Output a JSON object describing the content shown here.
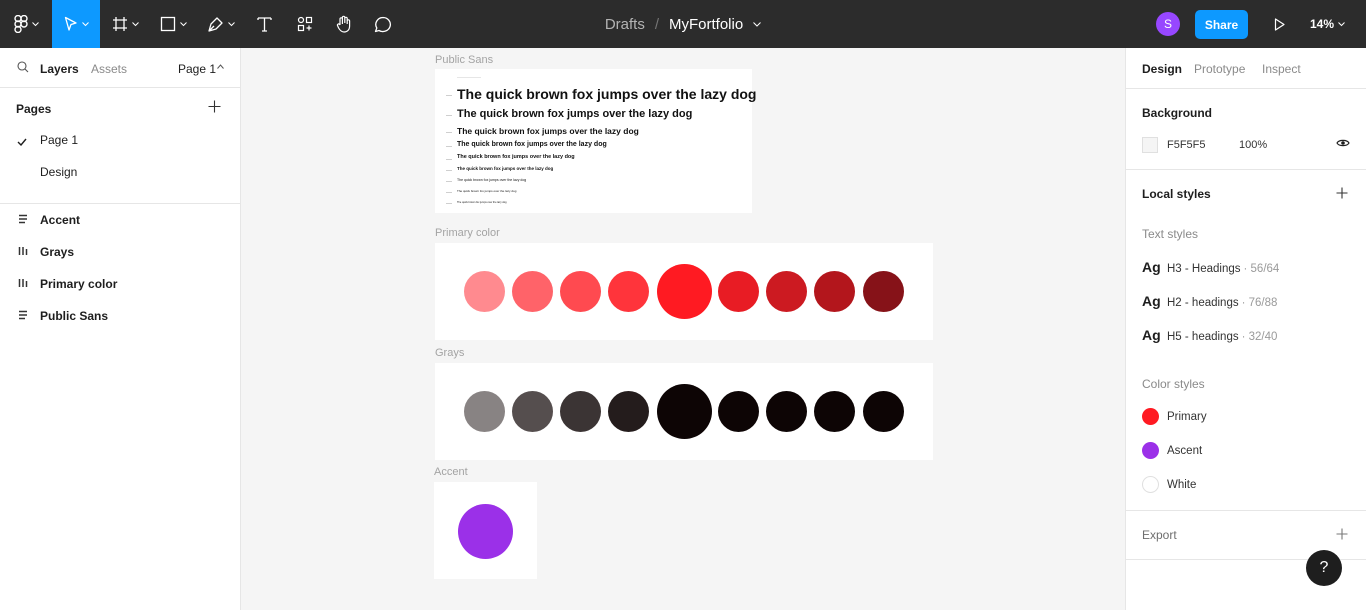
{
  "toolbar": {
    "breadcrumb_folder": "Drafts",
    "breadcrumb_separator": "/",
    "file_name": "MyFortfolio",
    "avatar_initial": "S",
    "share_label": "Share",
    "zoom_level": "14%"
  },
  "left_panel": {
    "tabs": {
      "layers": "Layers",
      "assets": "Assets"
    },
    "page_selector": "Page 1",
    "pages_heading": "Pages",
    "pages": [
      {
        "label": "Page 1",
        "selected": true
      },
      {
        "label": "Design",
        "selected": false
      }
    ],
    "layers": [
      {
        "name": "Accent",
        "icon": "vertical-stack-icon"
      },
      {
        "name": "Grays",
        "icon": "horizontal-stack-icon"
      },
      {
        "name": "Primary color",
        "icon": "horizontal-stack-icon"
      },
      {
        "name": "Public Sans",
        "icon": "vertical-stack-icon"
      }
    ]
  },
  "canvas": {
    "frames": {
      "public_sans": {
        "label": "Public Sans",
        "sample_text": "The quick brown fox jumps over the lazy dog"
      },
      "primary": {
        "label": "Primary color",
        "swatches": [
          "#ff8a8f",
          "#ff6369",
          "#ff4a50",
          "#ff343b",
          "#ff1a22",
          "#e81c24",
          "#cc1a21",
          "#b3161c",
          "#861218"
        ]
      },
      "grays": {
        "label": "Grays",
        "swatches": [
          "#888383",
          "#554e4e",
          "#3b3434",
          "#241c1c",
          "#0d0505",
          "#0d0505",
          "#0d0505",
          "#0d0505",
          "#0d0505"
        ]
      },
      "accent": {
        "label": "Accent",
        "swatch": "#9b30e8"
      }
    }
  },
  "right_panel": {
    "tabs": {
      "design": "Design",
      "prototype": "Prototype",
      "inspect": "Inspect"
    },
    "background": {
      "heading": "Background",
      "hex": "F5F5F5",
      "opacity": "100%"
    },
    "local_styles_heading": "Local styles",
    "text_styles_heading": "Text styles",
    "text_styles": [
      {
        "ag": "Ag",
        "name": "H3 - Headings",
        "meta": "· 56/64"
      },
      {
        "ag": "Ag",
        "name": "H2 - headings",
        "meta": "· 76/88"
      },
      {
        "ag": "Ag",
        "name": "H5 - headings",
        "meta": "· 32/40"
      }
    ],
    "color_styles_heading": "Color styles",
    "color_styles": [
      {
        "name": "Primary",
        "color": "#ff1a22"
      },
      {
        "name": "Ascent",
        "color": "#9b30e8"
      },
      {
        "name": "White",
        "color": "#ffffff"
      }
    ],
    "export_heading": "Export"
  },
  "help_label": "?"
}
